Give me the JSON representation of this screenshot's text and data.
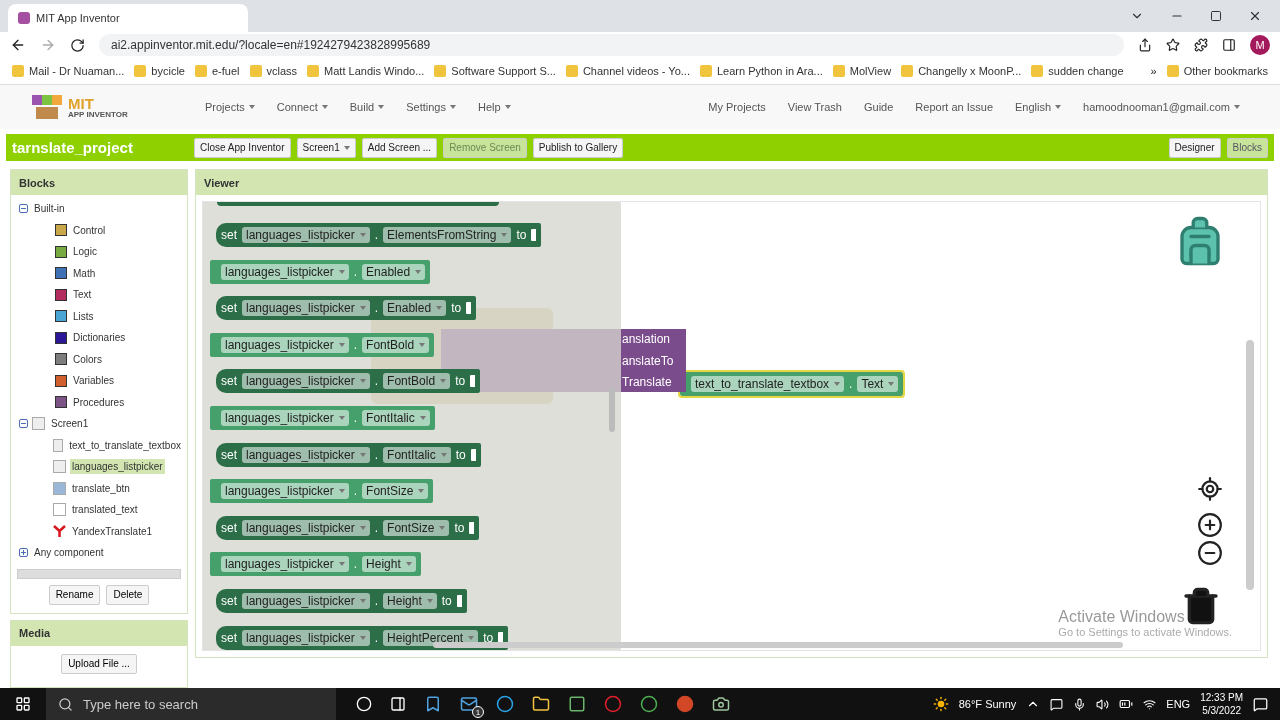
{
  "browser": {
    "tab_title": "MIT App Inventor",
    "url": "ai2.appinventor.mit.edu/?locale=en#1924279423828995689",
    "profile": "M",
    "bookmarks": [
      "Mail - Dr Nuaman...",
      "bycicle",
      "e-fuel",
      "vclass",
      "Matt Landis Windo...",
      "Software Support S...",
      "Channel videos - Yo...",
      "Learn Python in Ara...",
      "MolView",
      "Changelly x MoonP...",
      "sudden change"
    ],
    "more": "»",
    "other_bookmarks": "Other bookmarks"
  },
  "header": {
    "logo_top": "MIT",
    "logo_bottom": "APP INVENTOR",
    "menus": [
      "Projects",
      "Connect",
      "Build",
      "Settings",
      "Help"
    ],
    "links": [
      "My Projects",
      "View Trash",
      "Guide",
      "Report an Issue"
    ],
    "language": "English",
    "account": "hamoodnooman1@gmail.com"
  },
  "project_bar": {
    "name": "tarnslate_project",
    "buttons": [
      {
        "label": "Close App Inventor",
        "disabled": false,
        "dropdown": false
      },
      {
        "label": "Screen1",
        "disabled": false,
        "dropdown": true
      },
      {
        "label": "Add Screen ...",
        "disabled": false,
        "dropdown": false
      },
      {
        "label": "Remove Screen",
        "disabled": true,
        "dropdown": false
      },
      {
        "label": "Publish to Gallery",
        "disabled": false,
        "dropdown": false
      }
    ],
    "views": [
      {
        "label": "Designer",
        "selected": false
      },
      {
        "label": "Blocks",
        "selected": true
      }
    ]
  },
  "blocks_panel": {
    "title": "Blocks",
    "tree": [
      {
        "label": "Built-in",
        "kind": "group",
        "expanded": true,
        "children": [
          {
            "label": "Control",
            "kind": "category",
            "color": "#c8a84a"
          },
          {
            "label": "Logic",
            "kind": "category",
            "color": "#77ab41"
          },
          {
            "label": "Math",
            "kind": "category",
            "color": "#3f71b5"
          },
          {
            "label": "Text",
            "kind": "category",
            "color": "#b32d5e"
          },
          {
            "label": "Lists",
            "kind": "category",
            "color": "#49a6d4"
          },
          {
            "label": "Dictionaries",
            "kind": "category",
            "color": "#2d1799"
          },
          {
            "label": "Colors",
            "kind": "category",
            "color": "#7d7d7d"
          },
          {
            "label": "Variables",
            "kind": "category",
            "color": "#d05f2d"
          },
          {
            "label": "Procedures",
            "kind": "category",
            "color": "#7c5385"
          }
        ]
      },
      {
        "label": "Screen1",
        "kind": "screen",
        "expanded": true,
        "children": [
          {
            "label": "text_to_translate_textbox",
            "kind": "textbox",
            "selected": false
          },
          {
            "label": "languages_listpicker",
            "kind": "listpicker",
            "selected": true
          },
          {
            "label": "translate_btn",
            "kind": "button",
            "selected": false
          },
          {
            "label": "translated_text",
            "kind": "label",
            "selected": false
          },
          {
            "label": "YandexTranslate1",
            "kind": "translator",
            "selected": false
          }
        ]
      },
      {
        "label": "Any component",
        "kind": "group",
        "expanded": false
      }
    ],
    "buttons": [
      "Rename",
      "Delete"
    ]
  },
  "media_panel": {
    "title": "Media",
    "button": "Upload File ..."
  },
  "viewer": {
    "title": "Viewer",
    "drawer_blocks": [
      {
        "kind": "setter",
        "keyword": "set",
        "component": "languages_listpicker",
        "separator": ".",
        "property": "ElementsFromString",
        "suffix": "to"
      },
      {
        "kind": "getter",
        "component": "languages_listpicker",
        "separator": ".",
        "property": "Enabled"
      },
      {
        "kind": "setter",
        "keyword": "set",
        "component": "languages_listpicker",
        "separator": ".",
        "property": "Enabled",
        "suffix": "to"
      },
      {
        "kind": "getter",
        "component": "languages_listpicker",
        "separator": ".",
        "property": "FontBold"
      },
      {
        "kind": "setter",
        "keyword": "set",
        "component": "languages_listpicker",
        "separator": ".",
        "property": "FontBold",
        "suffix": "to"
      },
      {
        "kind": "getter",
        "component": "languages_listpicker",
        "separator": ".",
        "property": "FontItalic"
      },
      {
        "kind": "setter",
        "keyword": "set",
        "component": "languages_listpicker",
        "separator": ".",
        "property": "FontItalic",
        "suffix": "to"
      },
      {
        "kind": "getter",
        "component": "languages_listpicker",
        "separator": ".",
        "property": "FontSize"
      },
      {
        "kind": "setter",
        "keyword": "set",
        "component": "languages_listpicker",
        "separator": ".",
        "property": "FontSize",
        "suffix": "to"
      },
      {
        "kind": "getter",
        "component": "languages_listpicker",
        "separator": ".",
        "property": "Height"
      },
      {
        "kind": "setter",
        "keyword": "set",
        "component": "languages_listpicker",
        "separator": ".",
        "property": "Height",
        "suffix": "to"
      },
      {
        "kind": "setter",
        "keyword": "set",
        "component": "languages_listpicker",
        "separator": ".",
        "property": "HeightPercent",
        "suffix": "to"
      }
    ],
    "call_block": {
      "labels": [
        "anslation",
        "anslateTo",
        "Translate"
      ]
    },
    "attached_getter": {
      "component": "text_to_translate_textbox",
      "separator": ".",
      "property": "Text",
      "selected": true
    },
    "activation": {
      "title": "Activate Windows",
      "subtitle": "Go to Settings to activate Windows."
    }
  },
  "taskbar": {
    "search_placeholder": "Type here to search",
    "mail_badge": "1",
    "weather": "86°F Sunny",
    "language": "ENG",
    "time": "12:33 PM",
    "date": "5/3/2022"
  }
}
